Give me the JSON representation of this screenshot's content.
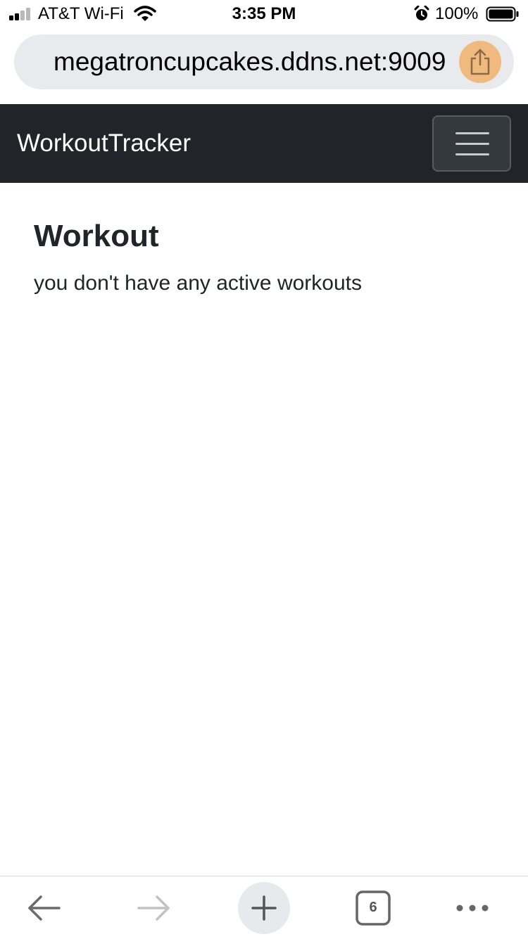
{
  "status_bar": {
    "carrier": "AT&T Wi-Fi",
    "time": "3:35 PM",
    "battery": "100%",
    "icons": [
      "signal-icon",
      "wifi-icon",
      "alarm-icon",
      "battery-icon"
    ]
  },
  "browser": {
    "url": "megatroncupcakes.ddns.net:9009",
    "share_icon": "share-icon",
    "accent_color": "#f0b26e",
    "tab_count": "6"
  },
  "navbar": {
    "brand": "WorkoutTracker",
    "toggler_icon": "hamburger-menu-icon",
    "background": "#212529"
  },
  "main": {
    "title": "Workout",
    "empty_message": "you don't have any active workouts"
  },
  "toolbar": {
    "icons": [
      "back-arrow-icon",
      "forward-arrow-icon",
      "plus-icon",
      "tabs-icon",
      "more-icon"
    ]
  }
}
